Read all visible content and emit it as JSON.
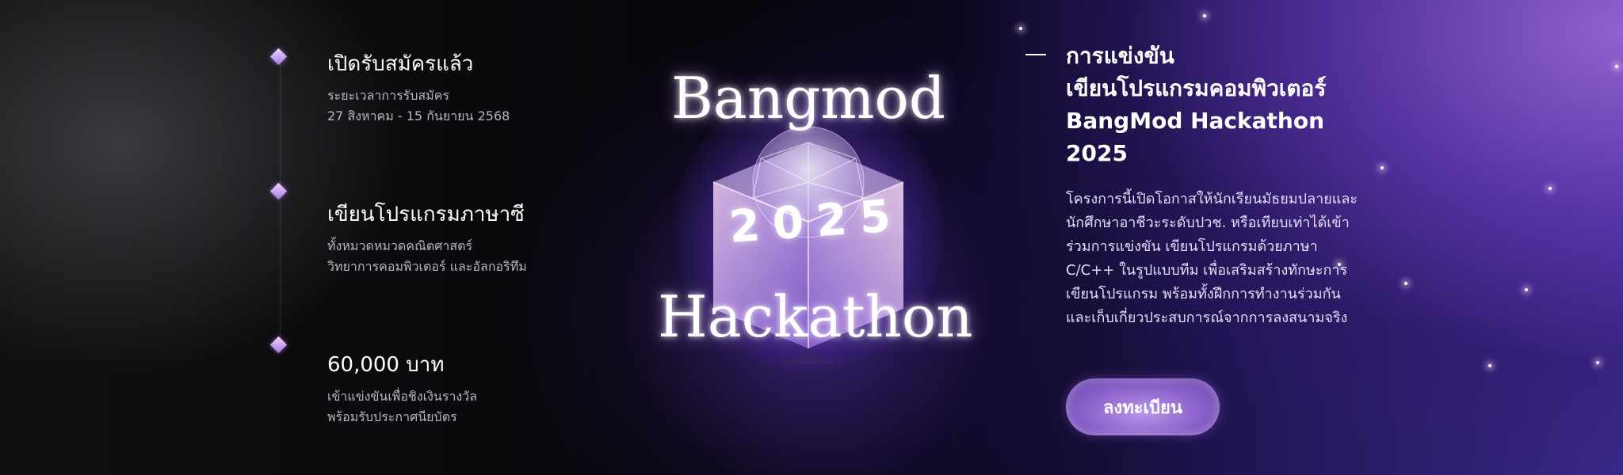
{
  "timeline": [
    {
      "title": "เปิดรับสมัครแล้ว",
      "desc1": "ระยะเวลาการรับสมัคร",
      "desc2": "27 สิงหาคม - 15 กันยายน 2568"
    },
    {
      "title": "เขียนโปรแกรมภาษาซี",
      "desc1": "ทั้งหมวดหมวดคณิตศาสตร์",
      "desc2": "วิทยาการคอมพิวเตอร์ และอัลกอริทึม"
    },
    {
      "title": "60,000 บาท",
      "desc1": "เข้าแข่งขันเพื่อชิงเงินรางวัล",
      "desc2": "พร้อมรับประกาศนียบัตร"
    }
  ],
  "art": {
    "top_word": "Bangmod",
    "year": "2025",
    "bottom_word": "Hackathon"
  },
  "headline": {
    "line1": "การแข่งขัน",
    "line2": "เขียนโปรแกรมคอมพิวเตอร์",
    "line3": "BangMod Hackathon",
    "line4": "2025"
  },
  "body": "โครงการนี้เปิดโอกาสให้นักเรียนมัธยมปลายและนักศึกษาอาชีวะระดับปวช. หรือเทียบเท่าได้เข้าร่วมการแข่งขัน เขียนโปรแกรมด้วยภาษา C/C++ ในรูปแบบทีม เพื่อเสริมสร้างทักษะการเขียนโปรแกรม พร้อมทั้งฝึกการทำงานร่วมกันและเก็บเกี่ยวประสบการณ์จากการลงสนามจริง",
  "cta_label": "ลงทะเบียน",
  "colors": {
    "accent": "#8a5fc9",
    "background_dark": "#050307",
    "background_purple": "#3a2888"
  }
}
